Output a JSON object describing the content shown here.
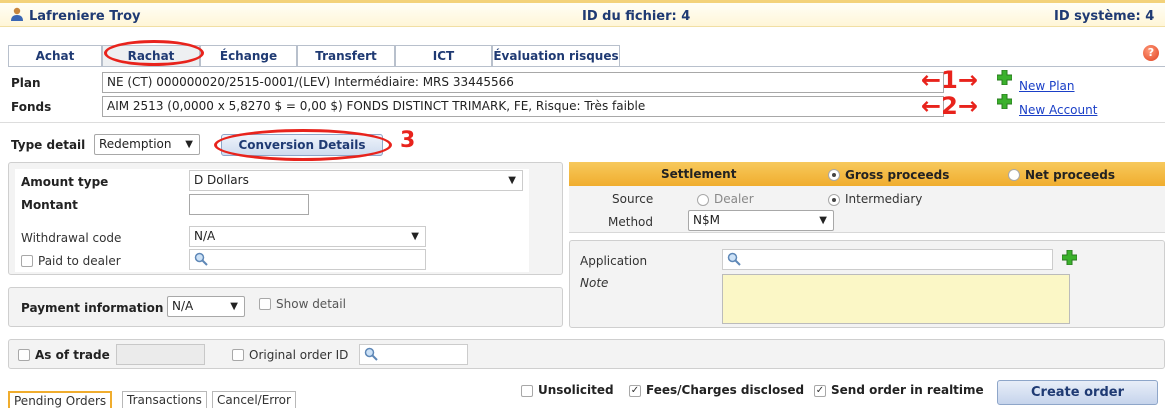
{
  "header": {
    "client_name": "Lafreniere Troy",
    "file_id": "ID du fichier: 4",
    "system_id": "ID système: 4"
  },
  "tabs": [
    "Achat",
    "Rachat",
    "Échange",
    "Transfert",
    "ICT",
    "Évaluation risques"
  ],
  "plan": {
    "label": "Plan",
    "value": "NE (CT) 000000020/2515-0001/(LEV) Intermédiaire: MRS 33445566",
    "new_link": "New Plan"
  },
  "fonds": {
    "label": "Fonds",
    "value": "AIM 2513 (0,0000 x 5,8270 $ = 0,00 $) FONDS DISTINCT TRIMARK, FE, Risque: Très faible",
    "new_link": "New Account"
  },
  "type_detail": {
    "label": "Type detail",
    "value": "Redemption",
    "conversion_button": "Conversion Details"
  },
  "annotations": [
    "1",
    "2",
    "3"
  ],
  "left_panel": {
    "amount_type_label": "Amount type",
    "amount_type_value": "D Dollars",
    "montant_label": "Montant",
    "withdrawal_label": "Withdrawal code",
    "withdrawal_value": "N/A",
    "paid_to_dealer_label": "Paid to dealer"
  },
  "payment": {
    "label": "Payment information",
    "value": "N/A",
    "show_detail": "Show detail"
  },
  "settlement": {
    "label": "Settlement",
    "gross": "Gross proceeds",
    "net": "Net proceeds",
    "source_label": "Source",
    "dealer": "Dealer",
    "intermediary": "Intermediary",
    "method_label": "Method",
    "method_value": "N$M"
  },
  "application": {
    "label": "Application",
    "note_label": "Note"
  },
  "as_of_trade": {
    "label": "As of trade",
    "original_order_label": "Original order ID"
  },
  "footer": {
    "unsolicited": "Unsolicited",
    "fees": "Fees/Charges disclosed",
    "send_realtime": "Send order in realtime",
    "create_order": "Create order"
  },
  "bottom_tabs": [
    "Pending Orders",
    "Transactions",
    "Cancel/Error"
  ],
  "colors": {
    "accent_red": "#e8231c",
    "settlement_bar": "#f2b33a",
    "navy": "#1f3a73",
    "link": "#1a3fc7"
  }
}
